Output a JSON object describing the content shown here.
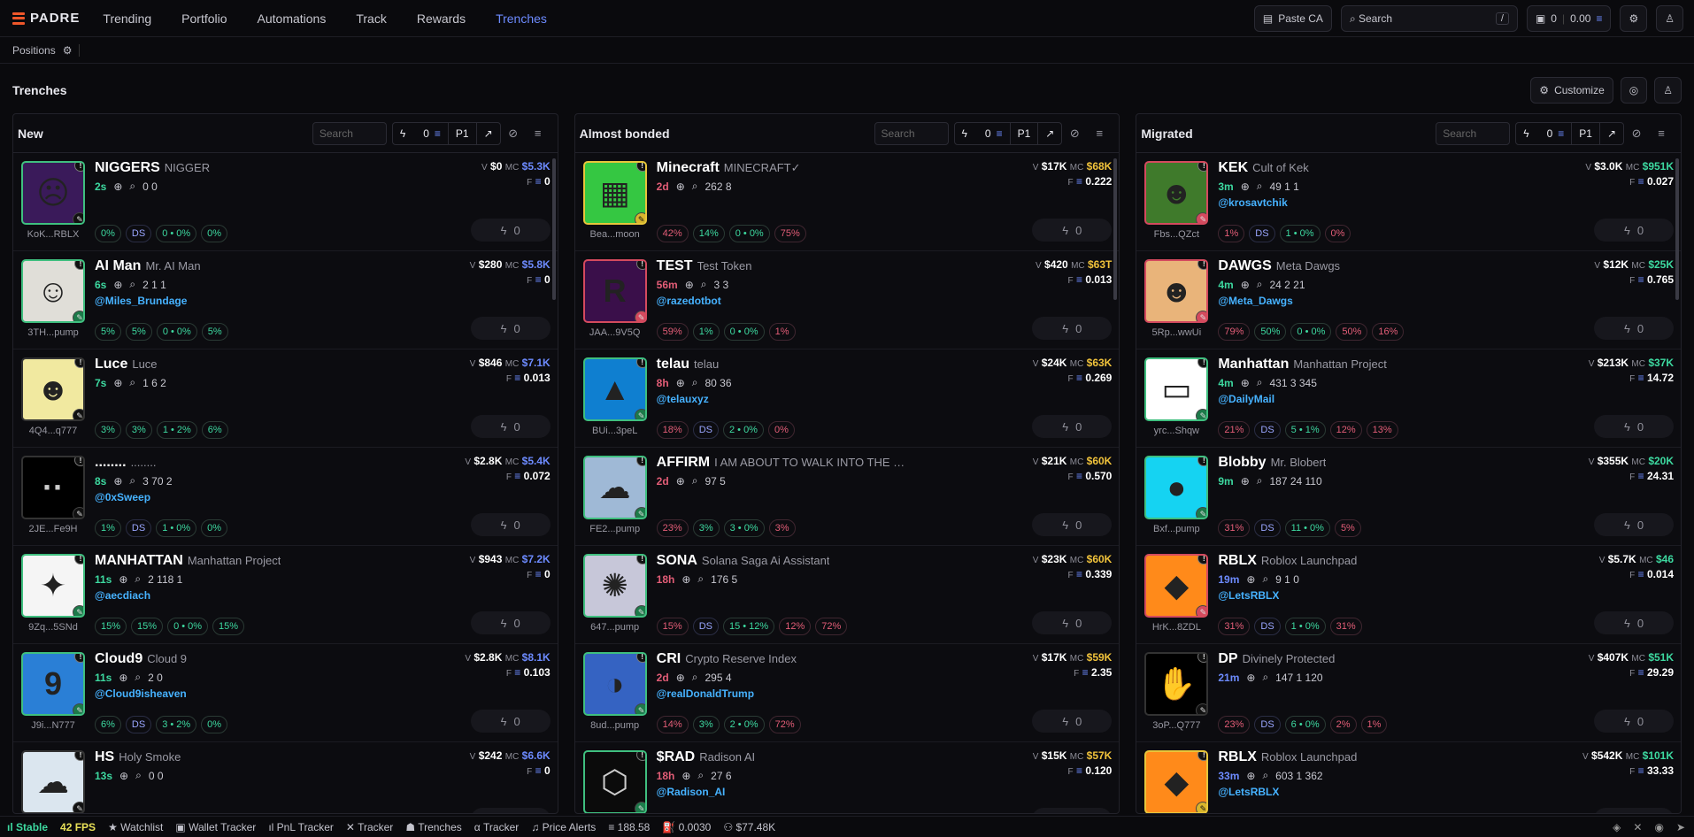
{
  "app": {
    "logo": "PADRE",
    "nav": [
      "Trending",
      "Portfolio",
      "Automations",
      "Track",
      "Rewards",
      "Trenches"
    ],
    "paste_ca": "Paste CA",
    "search_placeholder": "Search",
    "search_kbd": "/",
    "wallet_count": "0",
    "balance": "0.00"
  },
  "positions": {
    "label": "Positions"
  },
  "page": {
    "title": "Trenches",
    "customize": "Customize"
  },
  "columns": [
    {
      "name": "New",
      "search": "Search",
      "amount": "0",
      "preset": "P1",
      "cards": [
        {
          "sym": "NIGGERS",
          "full": "NIGGER",
          "age": "2s",
          "addr": "KoK...RBLX",
          "stats": "0 0",
          "v": "$0",
          "mc": "$5.3K",
          "f": "0",
          "handle": "",
          "chips": [
            "0%",
            "DS",
            "0 • 0%",
            "0%"
          ]
        },
        {
          "sym": "AI Man",
          "full": "Mr. AI Man",
          "age": "6s",
          "addr": "3TH...pump",
          "stats": "2 1 1",
          "v": "$280",
          "mc": "$5.8K",
          "f": "0",
          "handle": "@Miles_Brundage",
          "chips": [
            "5%",
            "5%",
            "0 • 0%",
            "5%"
          ]
        },
        {
          "sym": "Luce",
          "full": "Luce",
          "age": "7s",
          "addr": "4Q4...q777",
          "stats": "1 6 2",
          "v": "$846",
          "mc": "$7.1K",
          "f": "0.013",
          "handle": "",
          "chips": [
            "3%",
            "3%",
            "1 • 2%",
            "6%"
          ]
        },
        {
          "sym": "........",
          "full": "........",
          "age": "8s",
          "addr": "2JE...Fe9H",
          "stats": "3 70 2",
          "v": "$2.8K",
          "mc": "$5.4K",
          "f": "0.072",
          "handle": "@0xSweep",
          "chips": [
            "1%",
            "DS",
            "1 • 0%",
            "0%"
          ]
        },
        {
          "sym": "MANHATTAN",
          "full": "Manhattan Project",
          "age": "11s",
          "addr": "9Zq...5SNd",
          "stats": "2 118 1",
          "v": "$943",
          "mc": "$7.2K",
          "f": "0",
          "handle": "@aecdiach",
          "chips": [
            "15%",
            "15%",
            "0 • 0%",
            "15%"
          ]
        },
        {
          "sym": "Cloud9",
          "full": "Cloud 9",
          "age": "11s",
          "addr": "J9i...N777",
          "stats": "2 0",
          "v": "$2.8K",
          "mc": "$8.1K",
          "f": "0.103",
          "handle": "@Cloud9isheaven",
          "chips": [
            "6%",
            "DS",
            "3 • 2%",
            "0%"
          ]
        },
        {
          "sym": "HS",
          "full": "Holy Smoke",
          "age": "13s",
          "addr": "",
          "stats": "0 0",
          "v": "$242",
          "mc": "$6.6K",
          "f": "0",
          "handle": "",
          "chips": []
        }
      ]
    },
    {
      "name": "Almost bonded",
      "search": "Search",
      "amount": "0",
      "preset": "P1",
      "cards": [
        {
          "sym": "Minecraft",
          "full": "MINECRAFT✓",
          "age": "2d",
          "addr": "Bea...moon",
          "stats": "262 8",
          "v": "$17K",
          "mc": "$68K",
          "f": "0.222",
          "handle": "",
          "chips": [
            "42%",
            "14%",
            "0 • 0%",
            "75%"
          ]
        },
        {
          "sym": "TEST",
          "full": "Test Token",
          "age": "56m",
          "addr": "JAA...9V5Q",
          "stats": "3 3",
          "v": "$420",
          "mc": "$63T",
          "f": "0.013",
          "handle": "@razedotbot",
          "chips": [
            "59%",
            "1%",
            "0 • 0%",
            "1%"
          ]
        },
        {
          "sym": "telau",
          "full": "telau",
          "age": "8h",
          "addr": "BUi...3peL",
          "stats": "80 36",
          "v": "$24K",
          "mc": "$63K",
          "f": "0.269",
          "handle": "@telauxyz",
          "chips": [
            "18%",
            "DS",
            "2 • 0%",
            "0%"
          ]
        },
        {
          "sym": "AFFIRM",
          "full": "I AM ABOUT TO WALK INTO THE MO",
          "age": "2d",
          "addr": "FE2...pump",
          "stats": "97 5",
          "v": "$21K",
          "mc": "$60K",
          "f": "0.570",
          "handle": "",
          "chips": [
            "23%",
            "3%",
            "3 • 0%",
            "3%"
          ]
        },
        {
          "sym": "SONA",
          "full": "Solana Saga Ai Assistant",
          "age": "18h",
          "addr": "647...pump",
          "stats": "176 5",
          "v": "$23K",
          "mc": "$60K",
          "f": "0.339",
          "handle": "",
          "chips": [
            "15%",
            "DS",
            "15 • 12%",
            "12%",
            "72%"
          ]
        },
        {
          "sym": "CRI",
          "full": "Crypto Reserve Index",
          "age": "2d",
          "addr": "8ud...pump",
          "stats": "295 4",
          "v": "$17K",
          "mc": "$59K",
          "f": "2.35",
          "handle": "@realDonaldTrump",
          "chips": [
            "14%",
            "3%",
            "2 • 0%",
            "72%"
          ]
        },
        {
          "sym": "$RAD",
          "full": "Radison AI",
          "age": "18h",
          "addr": "",
          "stats": "27 6",
          "v": "$15K",
          "mc": "$57K",
          "f": "0.120",
          "handle": "@Radison_AI",
          "chips": []
        }
      ]
    },
    {
      "name": "Migrated",
      "search": "Search",
      "amount": "0",
      "preset": "P1",
      "cards": [
        {
          "sym": "KEK",
          "full": "Cult of Kek",
          "age": "3m",
          "addr": "Fbs...QZct",
          "stats": "49 1 1",
          "v": "$3.0K",
          "mc": "$951K",
          "f": "0.027",
          "handle": "@krosavtchik",
          "chips": [
            "1%",
            "DS",
            "1 • 0%",
            "0%"
          ]
        },
        {
          "sym": "DAWGS",
          "full": "Meta Dawgs",
          "age": "4m",
          "addr": "5Rp...wwUi",
          "stats": "24 2 21",
          "v": "$12K",
          "mc": "$25K",
          "f": "0.765",
          "handle": "@Meta_Dawgs",
          "chips": [
            "79%",
            "50%",
            "0 • 0%",
            "50%",
            "16%"
          ]
        },
        {
          "sym": "Manhattan",
          "full": "Manhattan Project",
          "age": "4m",
          "addr": "yrc...Shqw",
          "stats": "431 3 345",
          "v": "$213K",
          "mc": "$37K",
          "f": "14.72",
          "handle": "@DailyMail",
          "chips": [
            "21%",
            "DS",
            "5 • 1%",
            "12%",
            "13%"
          ]
        },
        {
          "sym": "Blobby",
          "full": "Mr. Blobert",
          "age": "9m",
          "addr": "Bxf...pump",
          "stats": "187 24 110",
          "v": "$355K",
          "mc": "$20K",
          "f": "24.31",
          "handle": "",
          "chips": [
            "31%",
            "DS",
            "11 • 0%",
            "5%"
          ]
        },
        {
          "sym": "RBLX",
          "full": "Roblox Launchpad",
          "age": "19m",
          "addr": "HrK...8ZDL",
          "stats": "9 1 0",
          "v": "$5.7K",
          "mc": "$46",
          "f": "0.014",
          "handle": "@LetsRBLX",
          "chips": [
            "31%",
            "DS",
            "1 • 0%",
            "31%"
          ]
        },
        {
          "sym": "DP",
          "full": "Divinely Protected",
          "age": "21m",
          "addr": "3oP...Q777",
          "stats": "147 1 120",
          "v": "$407K",
          "mc": "$51K",
          "f": "29.29",
          "handle": "",
          "chips": [
            "23%",
            "DS",
            "6 • 0%",
            "2%",
            "1%"
          ]
        },
        {
          "sym": "RBLX",
          "full": "Roblox Launchpad",
          "age": "33m",
          "addr": "",
          "stats": "603 1 362",
          "v": "$542K",
          "mc": "$101K",
          "f": "33.33",
          "handle": "@LetsRBLX",
          "chips": []
        }
      ]
    }
  ],
  "bottom": {
    "stable": "Stable",
    "fps": "42 FPS",
    "items": [
      "Watchlist",
      "Wallet Tracker",
      "PnL Tracker",
      "Tracker",
      "Trenches",
      "Tracker",
      "Price Alerts"
    ],
    "sol": "188.58",
    "gas": "0.0030",
    "fee": "$77.48K"
  }
}
